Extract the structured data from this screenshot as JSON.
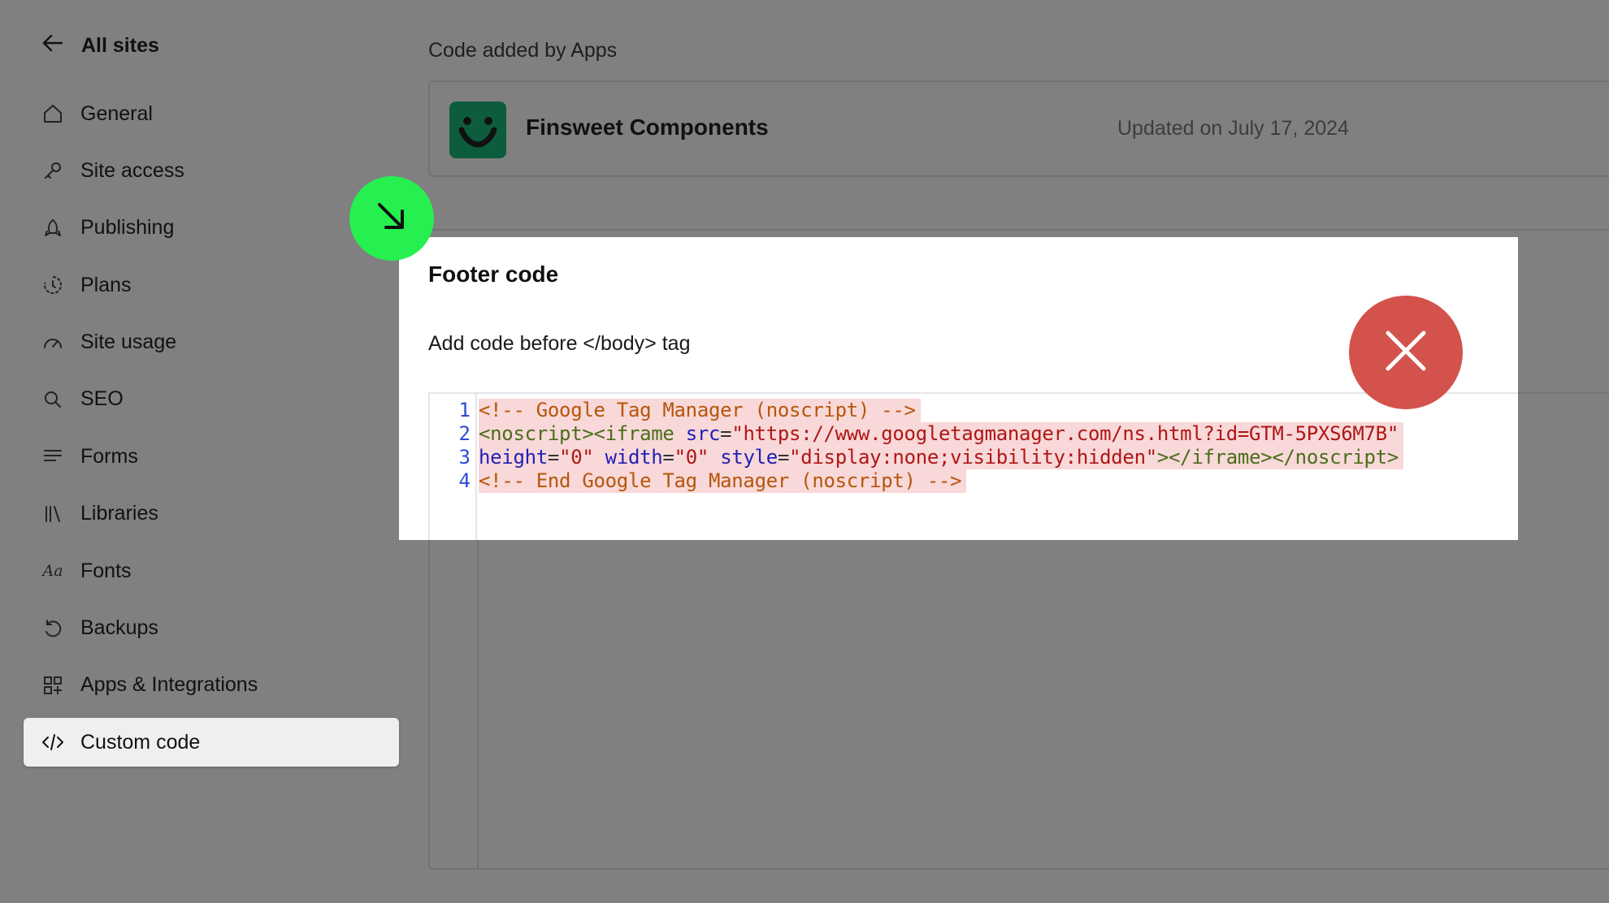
{
  "sidebar": {
    "back_label": "All sites",
    "items": [
      {
        "label": "General",
        "icon": "home-icon"
      },
      {
        "label": "Site access",
        "icon": "key-icon"
      },
      {
        "label": "Publishing",
        "icon": "rocket-icon"
      },
      {
        "label": "Plans",
        "icon": "plan-cycle-icon"
      },
      {
        "label": "Site usage",
        "icon": "gauge-icon"
      },
      {
        "label": "SEO",
        "icon": "search-icon"
      },
      {
        "label": "Forms",
        "icon": "lines-icon"
      },
      {
        "label": "Libraries",
        "icon": "library-icon"
      },
      {
        "label": "Fonts",
        "icon": "fonts-icon"
      },
      {
        "label": "Backups",
        "icon": "backup-icon"
      },
      {
        "label": "Apps & Integrations",
        "icon": "apps-icon"
      },
      {
        "label": "Custom code",
        "icon": "code-icon",
        "active": true
      }
    ],
    "fonts_glyph": "Aa"
  },
  "main": {
    "apps_section_label": "Code added by Apps",
    "app": {
      "name": "Finsweet Components",
      "updated": "Updated on July 17, 2024"
    }
  },
  "modal": {
    "title": "Footer code",
    "description": "Add code before </body> tag",
    "line_numbers": [
      "1",
      "2",
      "3",
      "4"
    ],
    "code": {
      "line1": "<!-- Google Tag Manager (noscript) -->",
      "line2": {
        "tags": "<noscript><iframe",
        "attr": "src",
        "eq": "=",
        "value": "\"https://www.googletagmanager.com/ns.html?id=GTM-5PXS6M7B\""
      },
      "line3": {
        "attr1": "height",
        "eq1": "=",
        "val1": "\"0\"",
        "attr2": "width",
        "eq2": "=",
        "val2": "\"0\"",
        "attr3": "style",
        "eq3": "=",
        "val3": "\"display:none;visibility:hidden\"",
        "close": "></iframe></noscript>"
      },
      "line4": "<!-- End Google Tag Manager (noscript) -->"
    }
  },
  "overlays": {
    "green_button_icon": "arrow-down-right-icon",
    "red_button_icon": "close-icon"
  },
  "colors": {
    "green": "#25f04f",
    "red": "#d4524c",
    "app_logo": "#0e5c3e",
    "backdrop": "#808080"
  }
}
